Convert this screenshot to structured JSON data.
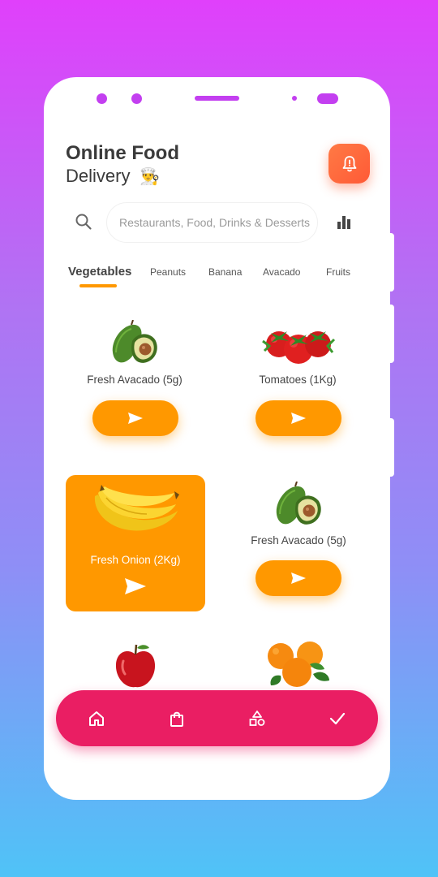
{
  "header": {
    "title_line1": "Online Food",
    "title_line2": "Delivery",
    "chef_emoji": "👨‍🍳"
  },
  "search": {
    "placeholder": "Restaurants, Food, Drinks & Desserts"
  },
  "tabs": [
    {
      "label": "Vegetables",
      "active": true
    },
    {
      "label": "Peanuts"
    },
    {
      "label": "Banana"
    },
    {
      "label": "Avacado"
    },
    {
      "label": "Fruits"
    }
  ],
  "products": [
    {
      "name": "Fresh Avacado (5g)",
      "image": "avocado"
    },
    {
      "name": "Tomatoes (1Kg)",
      "image": "tomatoes"
    },
    {
      "name": "Fresh Onion (2Kg)",
      "image": "bananas",
      "featured": true
    },
    {
      "name": "Fresh Avacado (5g)",
      "image": "avocado"
    },
    {
      "image": "apple"
    },
    {
      "image": "oranges"
    }
  ],
  "bottom_nav": [
    "home-icon",
    "shopping-bag-icon",
    "shapes-icon",
    "check-icon"
  ],
  "colors": {
    "accent": "#ff9800",
    "nav": "#ea1e63",
    "bell": "#ff6a3d"
  }
}
